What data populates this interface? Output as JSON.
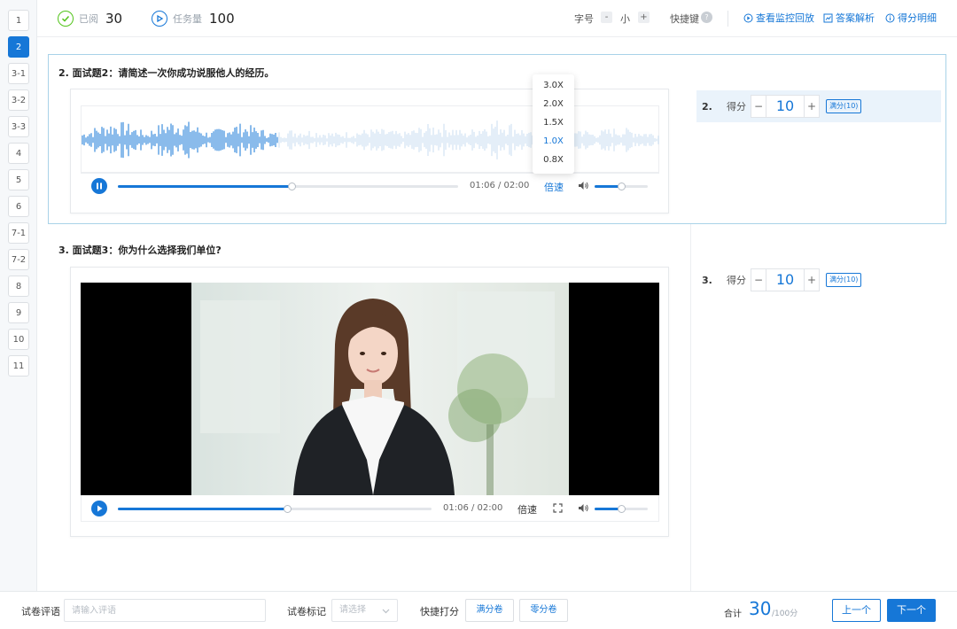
{
  "nav": {
    "items": [
      "1",
      "2",
      "3-1",
      "3-2",
      "3-3",
      "4",
      "5",
      "6",
      "7-1",
      "7-2",
      "8",
      "9",
      "10",
      "11"
    ],
    "active_index": 1
  },
  "topbar": {
    "reviewed_label": "已阅",
    "reviewed_count": "30",
    "task_label": "任务量",
    "task_count": "100",
    "font_label": "字号",
    "font_size": "小",
    "shortcut_label": "快捷键",
    "links": {
      "monitor_replay": "查看监控回放",
      "answer_analysis": "答案解析",
      "score_detail": "得分明细"
    }
  },
  "questions": [
    {
      "title": "2. 面试题2：请简述一次你成功说服他人的经历。",
      "time": "01:06 / 02:00",
      "speed_label": "倍速",
      "progress": 0.51,
      "volume": 0.5,
      "speed_options": [
        "3.0X",
        "2.0X",
        "1.5X",
        "1.0X",
        "0.8X"
      ],
      "selected_speed": "1.0X"
    },
    {
      "title": "3. 面试题3：你为什么选择我们单位?",
      "time": "01:06 / 02:00",
      "speed_label": "倍速",
      "progress": 0.54,
      "volume": 0.5
    }
  ],
  "scores": [
    {
      "num": "2.",
      "label": "得分",
      "value": "10",
      "full": "满分(10)"
    },
    {
      "num": "3.",
      "label": "得分",
      "value": "10",
      "full": "满分(10)"
    }
  ],
  "footer": {
    "comment_label": "试卷评语",
    "comment_placeholder": "请输入评语",
    "mark_label": "试卷标记",
    "mark_placeholder": "请选择",
    "quick_label": "快捷打分",
    "full_paper": "满分卷",
    "zero_paper": "零分卷",
    "total_label": "合计",
    "total_value": "30",
    "total_max": "/100分",
    "prev": "上一个",
    "next": "下一个"
  },
  "colors": {
    "accent": "#1677d7",
    "highlight_border": "#a9d2e8",
    "row_highlight": "#eaf3fb"
  }
}
